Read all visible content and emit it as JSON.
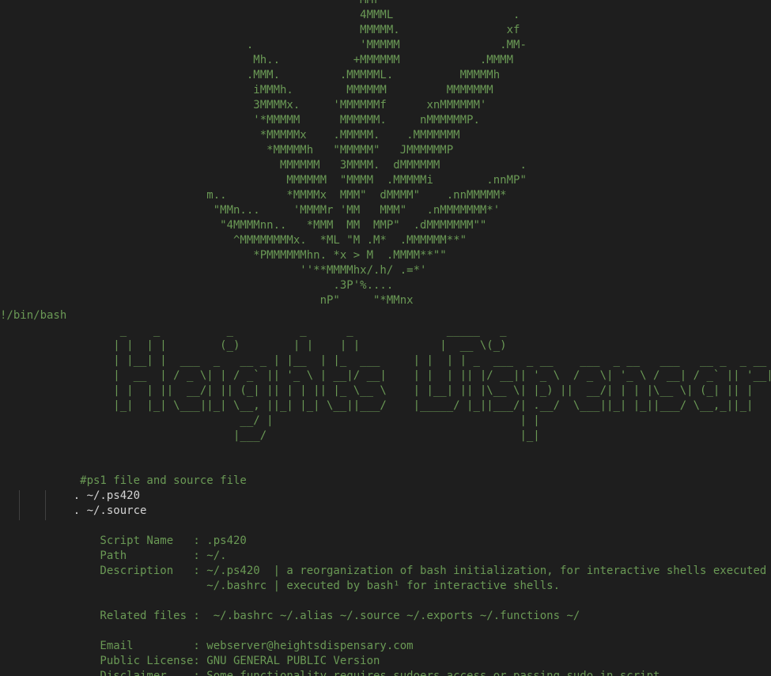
{
  "editor": {
    "theme": {
      "background": "#1e1e1e",
      "comment_color": "#6a9955",
      "code_color": "#d4d4d4",
      "indent_guide_color": "#404040"
    },
    "lines": [
      "                                                      MMr",
      "                                                      4MMML                  .",
      "                                                      MMMMM.                xf",
      "                                     .                'MMMMM               .MM-",
      "                                      Mh..           +MMMMMM            .MMMM",
      "                                     .MMM.         .MMMMML.          MMMMMh",
      "                                      iMMMh.        MMMMMM         MMMMMMM",
      "                                      3MMMMx.     'MMMMMMf      xnMMMMMM'",
      "                                      '*MMMMM      MMMMMM.     nMMMMMMP.",
      "                                       *MMMMMx    .MMMMM.    .MMMMMMM",
      "                                        *MMMMMh   \"MMMMM\"   JMMMMMMP",
      "                                          MMMMMM   3MMMM.  dMMMMMM            .",
      "                                           MMMMMM  \"MMMM  .MMMMMi        .nnMP\"",
      "                               m..         *MMMMx  MMM\"  dMMMM\"    .nnMMMMM*",
      "                                \"MMn...     'MMMMr 'MM   MMM\"   .nMMMMMMM*'",
      "                                 \"4MMMMnn..   *MMM  MM  MMP\"  .dMMMMMMM\"\"",
      "                                   ^MMMMMMMMx.  *ML \"M .M*  .MMMMMM**\"",
      "                                      *PMMMMMMhn. *x > M  .MMMM**\"\"",
      "                                             ''**MMMMhx/.h/ .=*'",
      "                                                  .3P'%....",
      "                                                nP\"     \"*MMnx",
      "!/bin/bash",
      "                  _    _          _          _      _              _____   _",
      "                 | |  | |        (_)        | |    | |            |  __ \\(_)",
      "                 | |__| |  ___  _   __ _ | |__  | |_  ___     | |  | | _  ___  _ __    ___  _ __   ___   __ _  _ __  _   _",
      "                 |  __  | / _ \\| | / _` || '_ \\ | __|/ __|    | |  | || |/ __|| '_ \\  / _ \\| '_ \\ / __| / _` || '__|| | | |",
      "                 | |  | ||  __/| || (_| || | | || |_ \\__ \\    | |__| || |\\__ \\| |_) ||  __/| | | |\\__ \\| (_| || |   | |_| |",
      "                 |_|  |_| \\___||_| \\__, ||_| |_| \\__||___/    |_____/ |_||___/| .__/  \\___||_| |_||___/ \\__,_||_|    \\__, |",
      "                                    __/ |                                     | |                                      __/ |",
      "                                   |___/                                      |_|                                     |___/",
      "",
      "",
      "            #ps1 file and source file",
      "           . ~/.ps420",
      "           . ~/.source",
      "",
      "               Script Name   : .ps420",
      "               Path          : ~/.",
      "               Description   : ~/.ps420  | a reorganization of bash initialization, for interactive shells executed",
      "                               ~/.bashrc | executed by bash¹ for interactive shells.",
      "",
      "               Related files :  ~/.bashrc ~/.alias ~/.source ~/.exports ~/.functions ~/",
      "",
      "               Email         : webserver@heightsdispensary.com",
      "               Public License: GNU GENERAL PUBLIC Version",
      "               Disclaimer    : Some functionality requires sudoers access or passing sudo in script."
    ]
  }
}
